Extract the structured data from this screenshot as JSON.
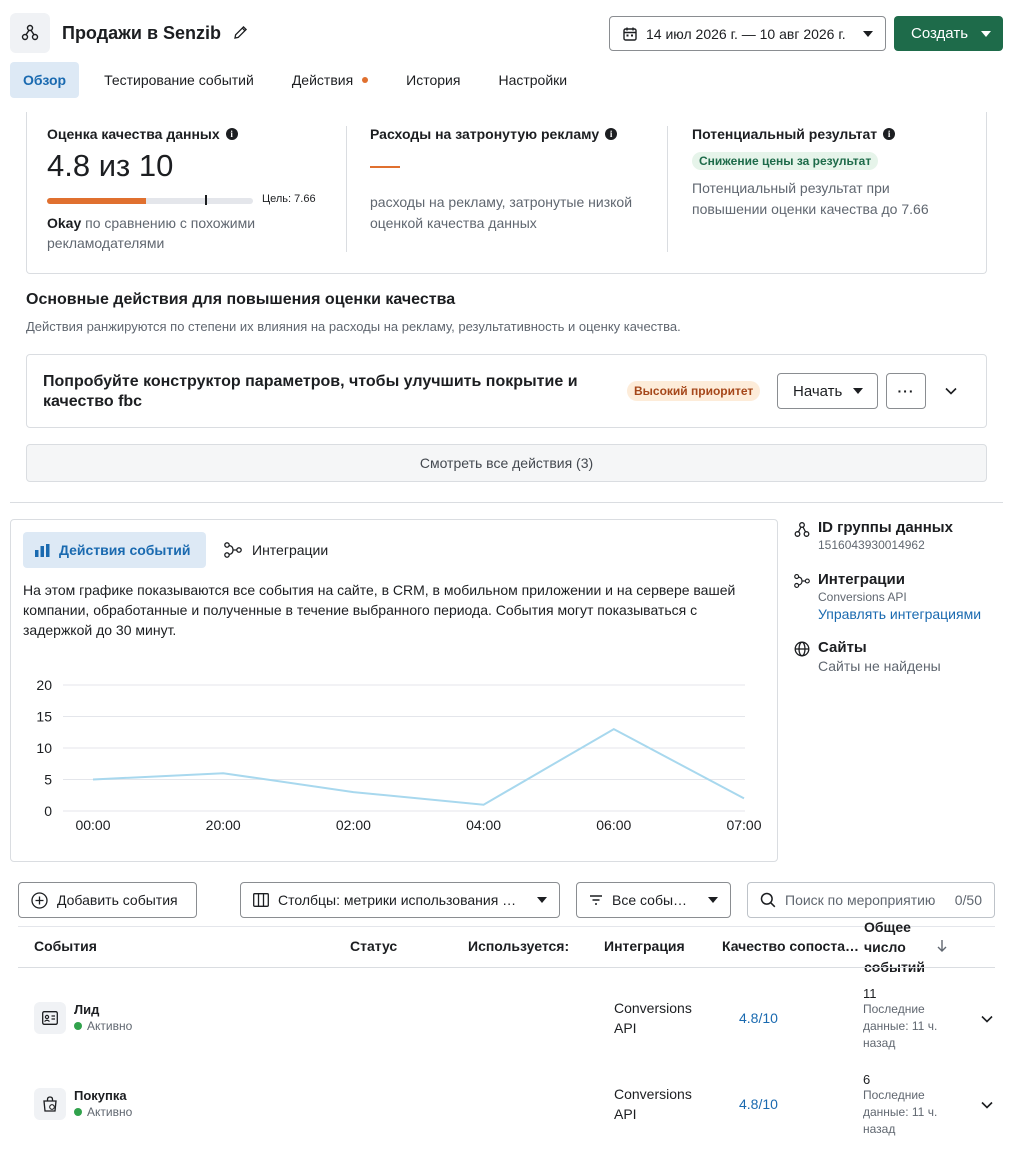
{
  "header": {
    "title": "Продажи в Senzib",
    "date_range": "14 июл 2026 г. — 10 авг 2026 г.",
    "create_label": "Создать"
  },
  "tabs": [
    {
      "label": "Обзор"
    },
    {
      "label": "Тестирование событий"
    },
    {
      "label": "Действия"
    },
    {
      "label": "История"
    },
    {
      "label": "Настройки"
    }
  ],
  "quality": {
    "title": "Оценка качества данных",
    "score": "4.8 из 10",
    "progress_fraction": 0.48,
    "target_fraction": 0.766,
    "goal": "Цель: 7.66",
    "okay_strong": "Okay",
    "okay_text": "по сравнению с похожими рекламодателями",
    "spend_title": "Расходы на затронутую рекламу",
    "spend_text": "расходы на рекламу, затронутые низкой оценкой качества данных",
    "result_title": "Потенциальный результат",
    "result_badge": "Снижение цены за результат",
    "result_text": "Потенциальный результат при повышении оценки качества до 7.66"
  },
  "actions_section": {
    "title": "Основные действия для повышения оценки качества",
    "subtitle": "Действия ранжируются по степени их влияния на расходы на рекламу, результативность и оценку качества.",
    "item_title": "Попробуйте конструктор параметров, чтобы улучшить покрытие и качество fbc",
    "priority": "Высокий приоритет",
    "start_label": "Начать",
    "more_label": "···",
    "see_all": "Смотреть все действия (3)"
  },
  "chart_panel": {
    "tab_events": "Действия событий",
    "tab_integrations": "Интеграции",
    "description": "На этом графике показываются все события на сайте, в CRM, в мобильном приложении и на сервере вашей компании, обработанные и полученные в течение выбранного периода. События могут показываться с задержкой до 30 минут."
  },
  "chart_data": {
    "type": "line",
    "title": "",
    "xlabel": "",
    "ylabel": "",
    "categories": [
      "00:00",
      "20:00",
      "02:00",
      "04:00",
      "06:00",
      "07:00"
    ],
    "values": [
      5,
      6,
      3,
      1,
      13,
      2
    ],
    "y_ticks": [
      "0",
      "5",
      "10",
      "15",
      "20"
    ],
    "ylim": [
      0,
      20
    ],
    "grid": true,
    "line_color": "#a8d8ee"
  },
  "side": {
    "dataset_title": "ID группы данных",
    "dataset_id": "1516043930014962",
    "integrations_title": "Интеграции",
    "integrations_sub": "Conversions API",
    "integrations_link": "Управлять интеграциями",
    "sites_title": "Сайты",
    "sites_sub": "Сайты не найдены"
  },
  "toolbar": {
    "add_events": "Добавить события",
    "columns": "Столбцы: метрики использования …",
    "all_events": "Все собы…",
    "search_placeholder": "Поиск по мероприятию",
    "search_count": "0/50"
  },
  "table": {
    "headers": {
      "events": "События",
      "status": "Статус",
      "used": "Используется:",
      "integration": "Интеграция",
      "match_quality": "Качество сопоста…",
      "total": "Общее число событий"
    },
    "rows": [
      {
        "name": "Лид",
        "status": "Активно",
        "integration": "Conversions API",
        "quality": "4.8/10",
        "total": "11",
        "last": "Последние данные: 11 ч. назад"
      },
      {
        "name": "Покупка",
        "status": "Активно",
        "integration": "Conversions API",
        "quality": "4.8/10",
        "total": "6",
        "last": "Последние данные: 11 ч. назад"
      }
    ]
  },
  "colors": {
    "accent": "#1a6ab0",
    "brand_green": "#1e6b4a",
    "warning": "#e0702f"
  }
}
